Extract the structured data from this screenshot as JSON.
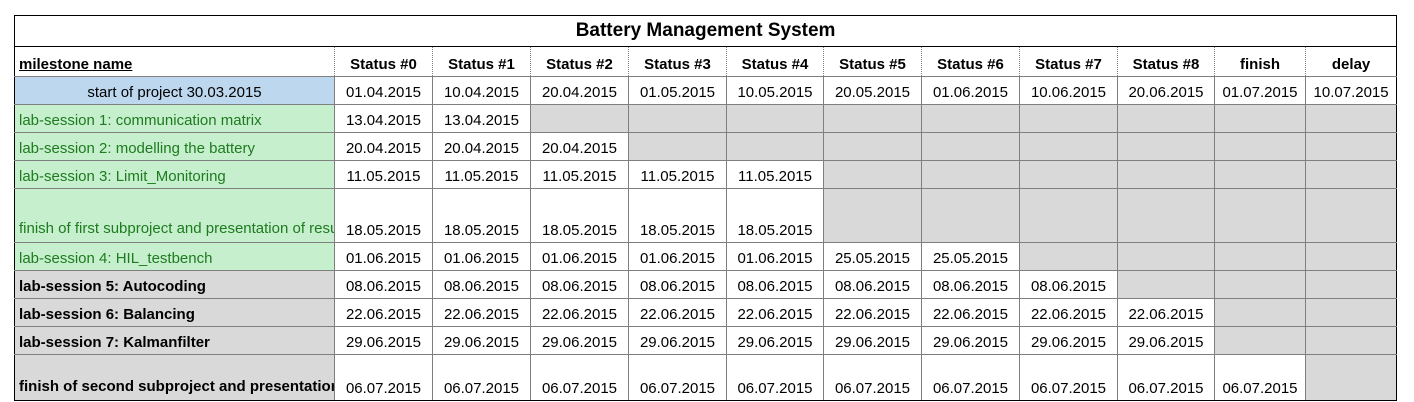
{
  "title": "Battery Management System",
  "columns": [
    "milestone name",
    "Status #0",
    "Status #1",
    "Status #2",
    "Status #3",
    "Status #4",
    "Status #5",
    "Status #6",
    "Status #7",
    "Status #8",
    "finish",
    "delay"
  ],
  "start_row": {
    "label": "start of project 30.03.2015",
    "values": [
      "01.04.2015",
      "10.04.2015",
      "20.04.2015",
      "01.05.2015",
      "10.05.2015",
      "20.05.2015",
      "01.06.2015",
      "10.06.2015",
      "20.06.2015",
      "01.07.2015",
      "10.07.2015"
    ]
  },
  "rows": [
    {
      "label": "lab-session 1: communication matrix",
      "values": [
        "13.04.2015",
        "13.04.2015",
        "",
        "",
        "",
        "",
        "",
        "",
        "",
        "",
        ""
      ]
    },
    {
      "label": "lab-session 2: modelling the battery",
      "values": [
        "20.04.2015",
        "20.04.2015",
        "20.04.2015",
        "",
        "",
        "",
        "",
        "",
        "",
        "",
        ""
      ]
    },
    {
      "label": "lab-session 3: Limit_Monitoring",
      "values": [
        "11.05.2015",
        "11.05.2015",
        "11.05.2015",
        "11.05.2015",
        "11.05.2015",
        "",
        "",
        "",
        "",
        "",
        ""
      ]
    },
    {
      "label": "finish of first subproject and presentation of results",
      "values": [
        "18.05.2015",
        "18.05.2015",
        "18.05.2015",
        "18.05.2015",
        "18.05.2015",
        "",
        "",
        "",
        "",
        "",
        ""
      ]
    },
    {
      "label": "lab-session 4: HIL_testbench",
      "values": [
        "01.06.2015",
        "01.06.2015",
        "01.06.2015",
        "01.06.2015",
        "01.06.2015",
        "25.05.2015",
        "25.05.2015",
        "",
        "",
        "",
        ""
      ]
    },
    {
      "label": "lab-session 5: Autocoding",
      "values": [
        "08.06.2015",
        "08.06.2015",
        "08.06.2015",
        "08.06.2015",
        "08.06.2015",
        "08.06.2015",
        "08.06.2015",
        "08.06.2015",
        "",
        "",
        ""
      ]
    },
    {
      "label": "lab-session 6: Balancing",
      "values": [
        "22.06.2015",
        "22.06.2015",
        "22.06.2015",
        "22.06.2015",
        "22.06.2015",
        "22.06.2015",
        "22.06.2015",
        "22.06.2015",
        "22.06.2015",
        "",
        ""
      ]
    },
    {
      "label": "lab-session 7: Kalmanfilter",
      "values": [
        "29.06.2015",
        "29.06.2015",
        "29.06.2015",
        "29.06.2015",
        "29.06.2015",
        "29.06.2015",
        "29.06.2015",
        "29.06.2015",
        "29.06.2015",
        "",
        ""
      ]
    },
    {
      "label": "finish of second subproject and presentation of results",
      "values": [
        "06.07.2015",
        "06.07.2015",
        "06.07.2015",
        "06.07.2015",
        "06.07.2015",
        "06.07.2015",
        "06.07.2015",
        "06.07.2015",
        "06.07.2015",
        "06.07.2015",
        ""
      ]
    }
  ],
  "colors": {
    "start_fill": "#bdd7ee",
    "green_fill": "#c6efce",
    "green_text": "#1e7b1e",
    "grey_fill": "#d9d9d9"
  }
}
